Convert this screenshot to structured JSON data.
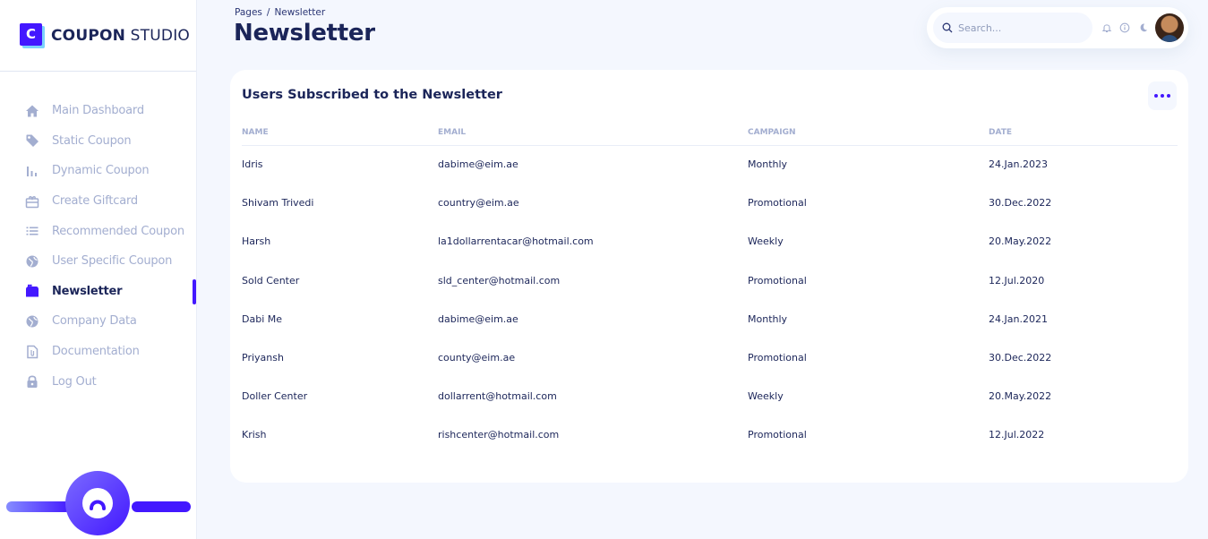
{
  "brand": {
    "logo_letter": "C",
    "name_bold": "COUPON",
    "name_rest": " STUDIO"
  },
  "sidebar": {
    "items": [
      {
        "label": "Main Dashboard",
        "icon": "home-icon"
      },
      {
        "label": "Static Coupon",
        "icon": "tag-icon"
      },
      {
        "label": "Dynamic Coupon",
        "icon": "bar-chart-icon"
      },
      {
        "label": "Create Giftcard",
        "icon": "gift-icon"
      },
      {
        "label": "Recommended Coupon",
        "icon": "list-icon"
      },
      {
        "label": "User Specific Coupon",
        "icon": "globe-icon"
      },
      {
        "label": "Newsletter",
        "icon": "mailbox-icon",
        "active": true
      },
      {
        "label": "Company Data",
        "icon": "globe-icon"
      },
      {
        "label": "Documentation",
        "icon": "document-icon"
      },
      {
        "label": "Log Out",
        "icon": "lock-icon"
      }
    ]
  },
  "header": {
    "breadcrumb": {
      "root": "Pages",
      "separator": "/",
      "current": "Newsletter"
    },
    "title": "Newsletter",
    "search_placeholder": "Search..."
  },
  "card": {
    "title": "Users Subscribed to the Newsletter",
    "columns": [
      "NAME",
      "EMAIL",
      "CAMPAIGN",
      "DATE"
    ],
    "rows": [
      [
        "Idris",
        "dabime@eim.ae",
        "Monthly",
        "24.Jan.2023"
      ],
      [
        "Shivam Trivedi",
        "country@eim.ae",
        "Promotional",
        "30.Dec.2022"
      ],
      [
        "Harsh",
        "la1dollarrentacar@hotmail.com",
        "Weekly",
        "20.May.2022"
      ],
      [
        "Sold Center",
        "sld_center@hotmail.com",
        "Promotional",
        "12.Jul.2020"
      ],
      [
        "Dabi Me",
        "dabime@eim.ae",
        "Monthly",
        "24.Jan.2021"
      ],
      [
        "Priyansh",
        "county@eim.ae",
        "Promotional",
        "30.Dec.2022"
      ],
      [
        "Doller Center",
        "dollarrent@hotmail.com",
        "Weekly",
        "20.May.2022"
      ],
      [
        "Krish",
        "rishcenter@hotmail.com",
        "Promotional",
        "12.Jul.2022"
      ]
    ]
  },
  "colors": {
    "accent": "#4318ff",
    "text": "#1b2559",
    "muted": "#a3aed0",
    "background": "#f4f7fe"
  }
}
